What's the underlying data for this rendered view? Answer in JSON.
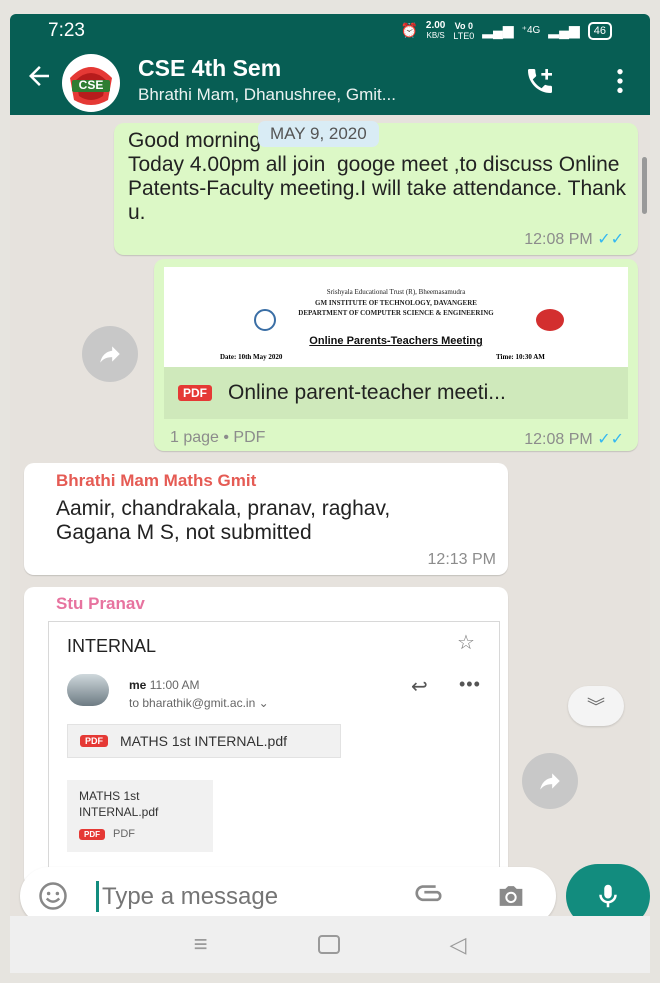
{
  "status": {
    "time": "7:23",
    "net_speed_top": "2.00",
    "net_speed_bottom": "KB/S",
    "volte_top": "Vo 0",
    "volte_bottom": "LTE0",
    "signal": "4G",
    "battery": "46"
  },
  "header": {
    "title": "CSE 4th Sem",
    "subtitle": "Bhrathi Mam, Dhanushree, Gmit...",
    "avatar_text": "CSE"
  },
  "date_chip": "MAY 9, 2020",
  "messages": {
    "m1": {
      "text": "Good morning\nToday 4.00pm all join  googe meet ,to discuss Online Patents-Faculty meeting.I will take attendance. Thank u.",
      "time": "12:08 PM"
    },
    "m2": {
      "preview": {
        "line1": "Srishyala Educational Trust (R), Bheemasamudra",
        "line2": "GM INSTITUTE OF TECHNOLOGY, DAVANGERE",
        "line3": "DEPARTMENT OF COMPUTER SCIENCE & ENGINEERING",
        "heading": "Online Parents-Teachers Meeting",
        "date": "Date: 10th May 2020",
        "time": "Time: 10:30 AM"
      },
      "file_name": "Online parent-teacher meeti...",
      "meta": "1 page • PDF",
      "time": "12:08 PM",
      "pdf_label": "PDF"
    },
    "m3": {
      "sender": "Bhrathi Mam Maths Gmit",
      "text": "Aamir, chandrakala, pranav, raghav, Gagana M  S, not submitted",
      "time": "12:13 PM"
    },
    "m4": {
      "sender": "Stu Pranav",
      "email": {
        "subject": "INTERNAL",
        "from": "me",
        "time": "11:00 AM",
        "to": "to bharathik@gmit.ac.in",
        "attachment_chip": "MATHS 1st INTERNAL.pdf",
        "card_name": "MATHS 1st\nINTERNAL.pdf",
        "card_type": "PDF",
        "pdf_label": "PDF"
      }
    }
  },
  "composer": {
    "placeholder": "Type a message"
  },
  "colors": {
    "header": "#075e54",
    "accent": "#128c7e",
    "outgoing": "#dcf8c6",
    "incoming": "#ffffff",
    "ticks": "#34b7f1",
    "sender1": "#e55b54",
    "sender2": "#e7739f"
  },
  "icons": [
    "back-arrow-icon",
    "add-call-icon",
    "more-vert-icon",
    "forward-icon",
    "pdf-icon",
    "star-icon",
    "reply-icon",
    "more-horiz-icon",
    "chevron-down-double-icon",
    "emoji-icon",
    "attach-icon",
    "camera-icon",
    "mic-icon",
    "menu-nav-icon",
    "home-nav-icon",
    "back-nav-icon"
  ]
}
